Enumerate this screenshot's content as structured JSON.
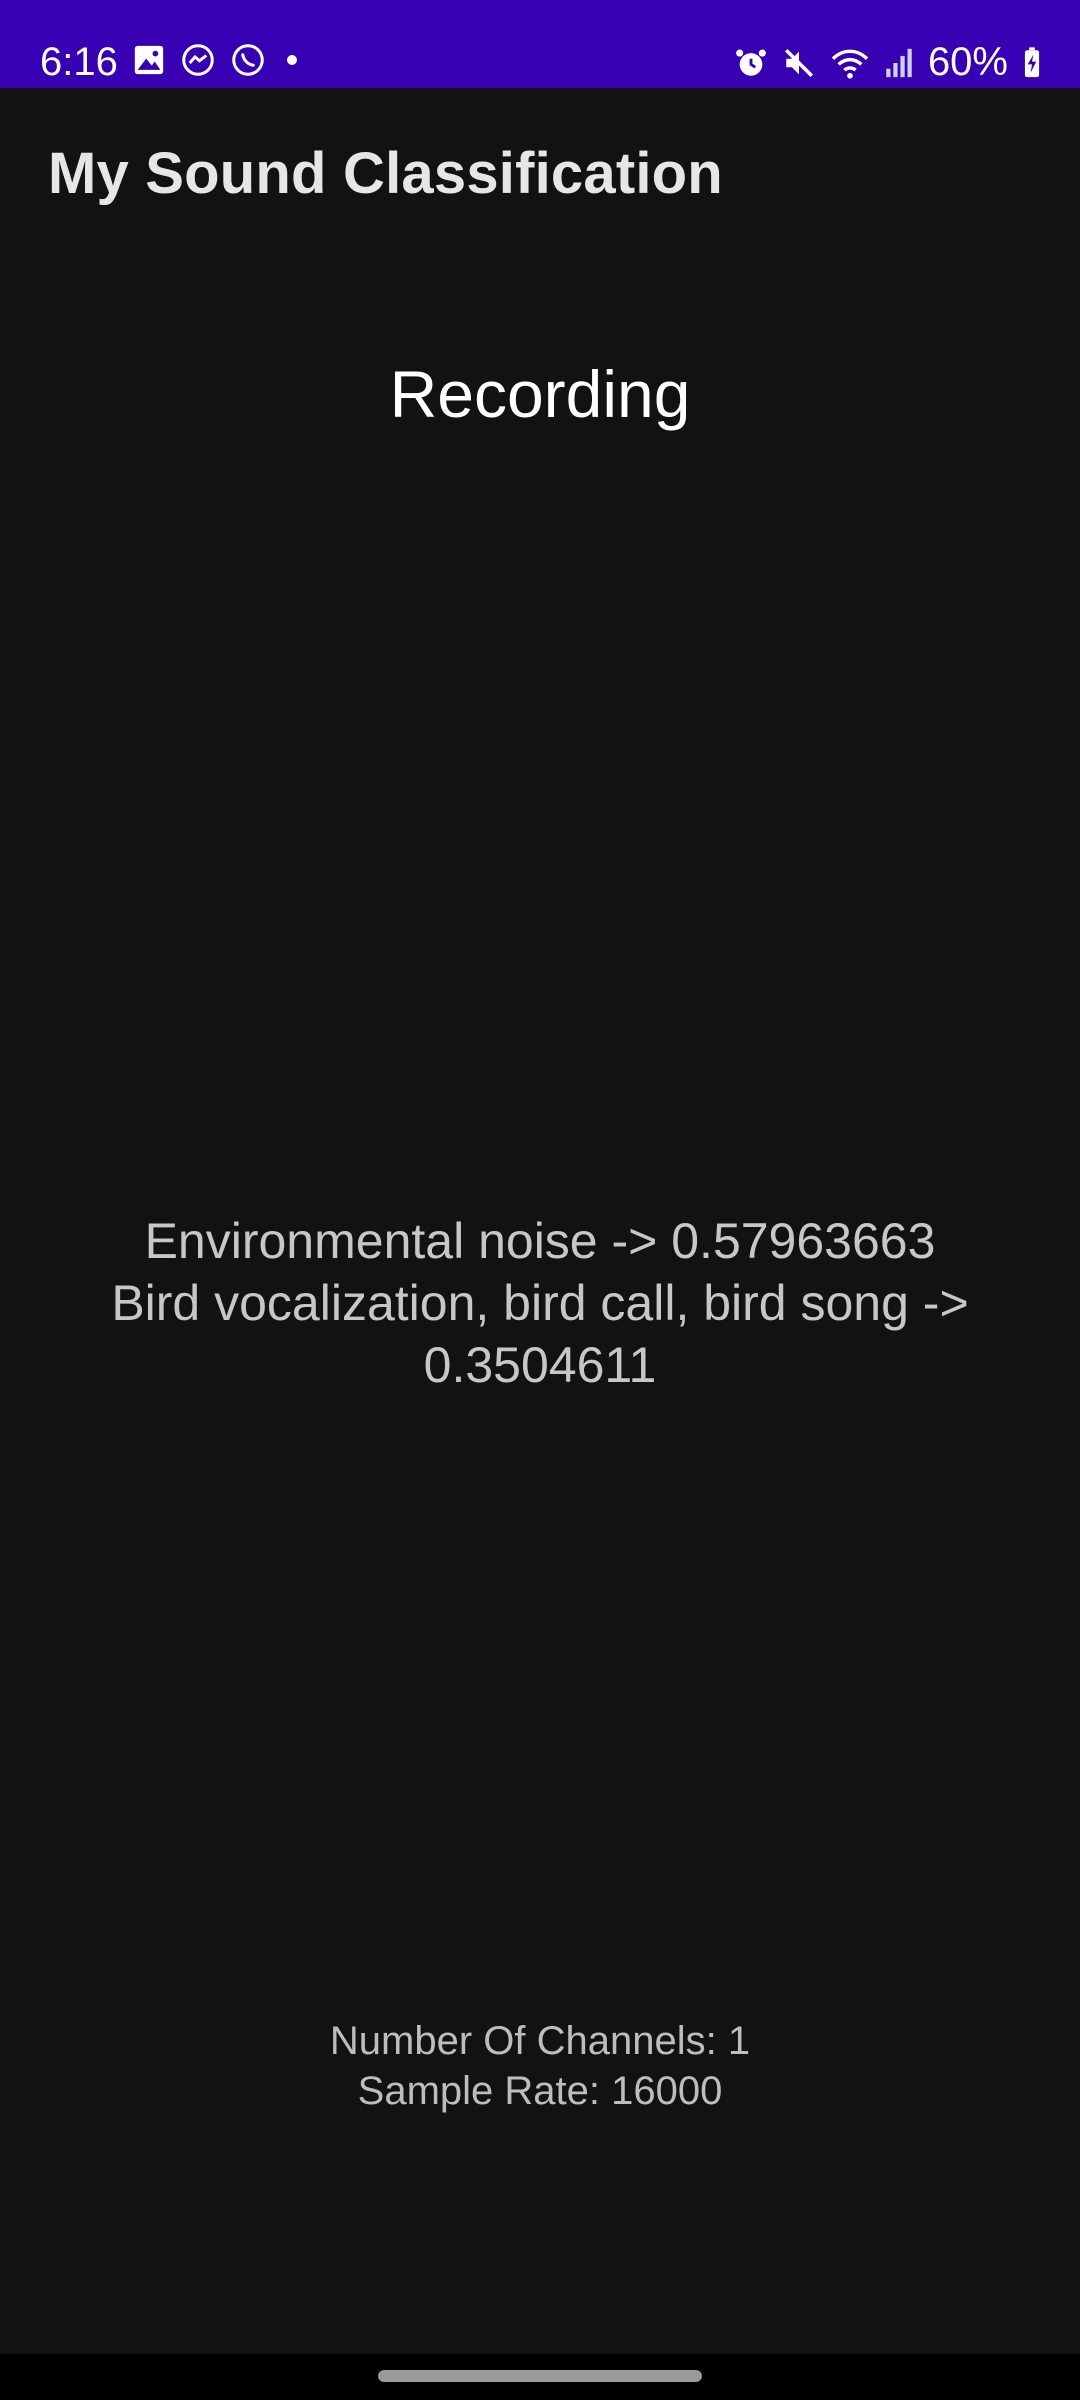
{
  "status_bar": {
    "time": "6:16",
    "battery": "60%",
    "background_color": "#3700b3",
    "left_icons": [
      "gallery-icon",
      "messenger-icon",
      "whatsapp-icon",
      "notification-dot-icon"
    ],
    "right_icons": [
      "alarm-icon",
      "mute-icon",
      "wifi-icon",
      "signal-icon",
      "battery-icon"
    ]
  },
  "app_bar": {
    "title": "My Sound Classification"
  },
  "main": {
    "status": "Recording",
    "results": [
      "Environmental noise -> 0.57963663",
      "Bird vocalization, bird call, bird song -> 0.3504611"
    ],
    "channels_text": "Number Of Channels: 1",
    "sample_rate_text": "Sample Rate: 16000"
  }
}
